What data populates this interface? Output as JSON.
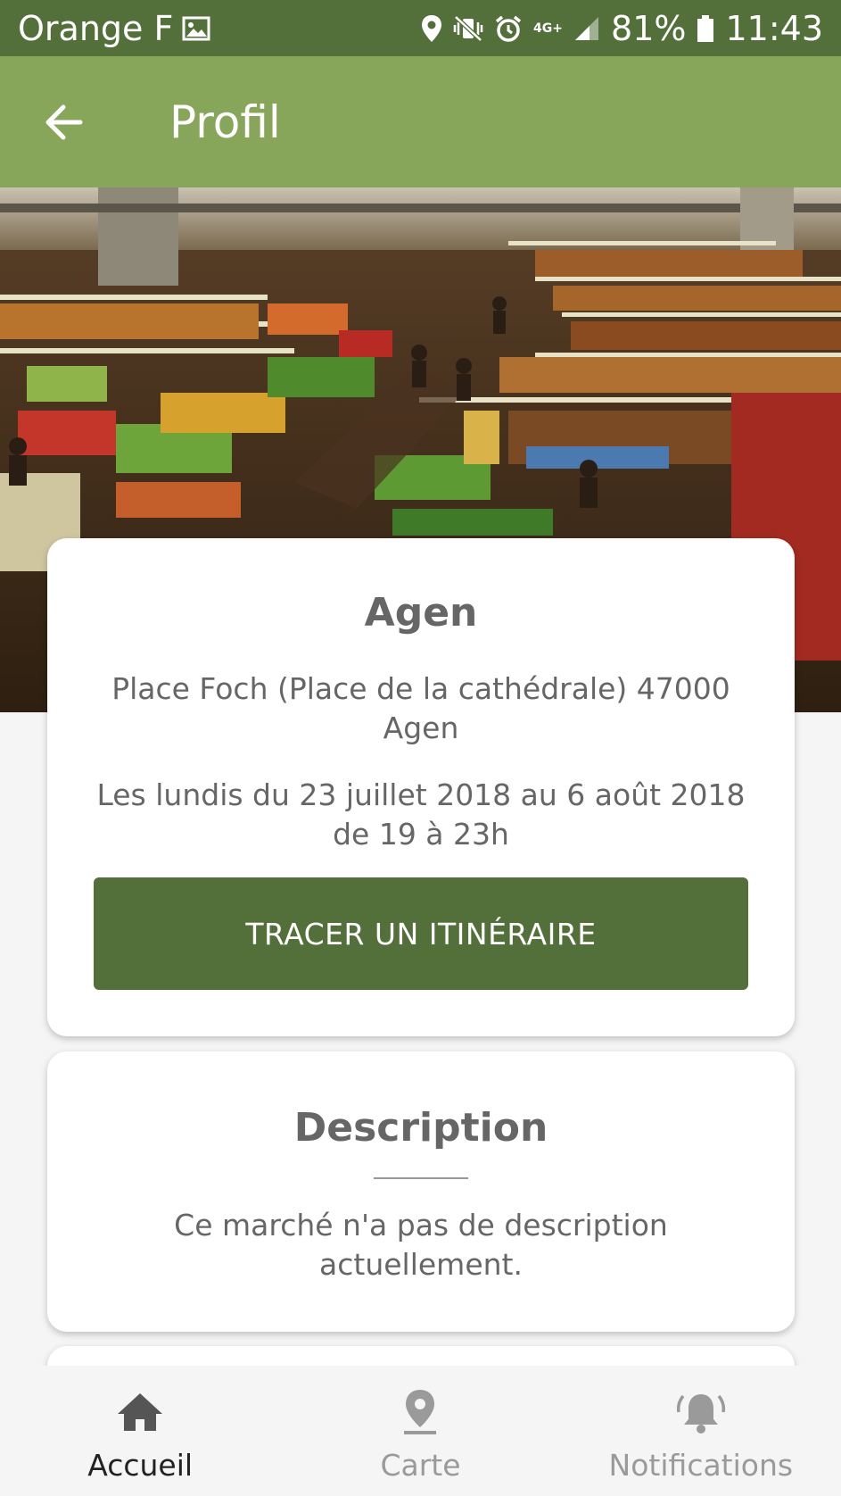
{
  "status_bar": {
    "carrier": "Orange F",
    "network": "4G+",
    "battery": "81%",
    "time": "11:43"
  },
  "app_bar": {
    "title": "Profil"
  },
  "market": {
    "name": "Agen",
    "address": "Place Foch (Place de la cathédrale) 47000 Agen",
    "dates": "Les lundis du 23 juillet 2018 au 6 août 2018 de 19 à 23h",
    "route_button": "TRACER UN ITINÉRAIRE"
  },
  "description": {
    "title": "Description",
    "text": "Ce marché n'a pas de description actuellement."
  },
  "bottom_nav": {
    "items": [
      {
        "label": "Accueil",
        "icon": "home-icon",
        "active": true
      },
      {
        "label": "Carte",
        "icon": "map-pin-icon",
        "active": false
      },
      {
        "label": "Notifications",
        "icon": "bell-icon",
        "active": false
      }
    ]
  },
  "colors": {
    "status_bar": "#54703a",
    "app_bar": "#87a65a",
    "button": "#54703a",
    "text": "#666666"
  }
}
